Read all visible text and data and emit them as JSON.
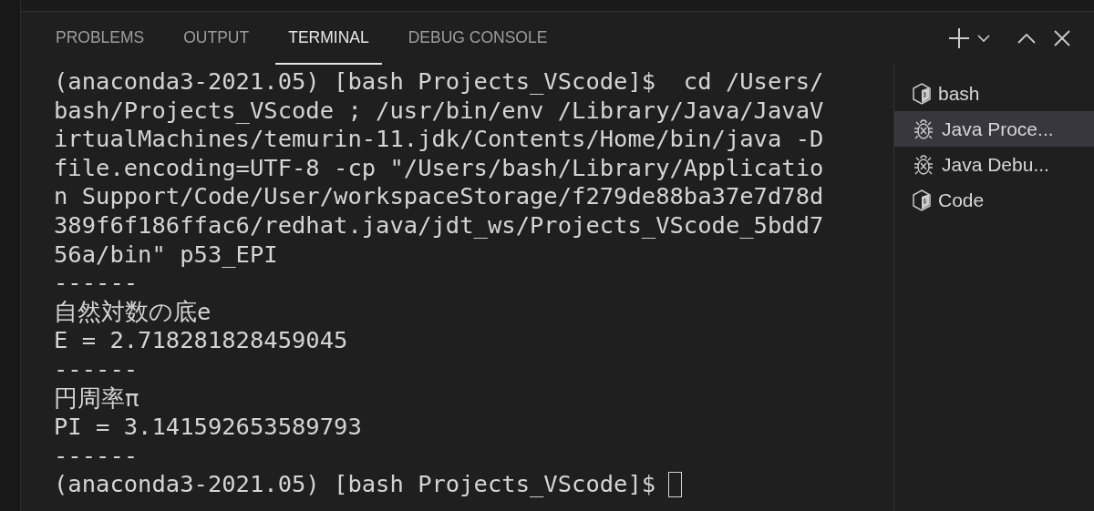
{
  "panel": {
    "tabs": [
      {
        "label": "PROBLEMS",
        "selected": false
      },
      {
        "label": "OUTPUT",
        "selected": false
      },
      {
        "label": "TERMINAL",
        "selected": true
      },
      {
        "label": "DEBUG CONSOLE",
        "selected": false
      }
    ]
  },
  "terminal": {
    "lines": [
      "(anaconda3-2021.05) [bash Projects_VScode]$  cd /Users/",
      "bash/Projects_VScode ; /usr/bin/env /Library/Java/JavaV",
      "irtualMachines/temurin-11.jdk/Contents/Home/bin/java -D",
      "file.encoding=UTF-8 -cp \"/Users/bash/Library/Applicatio",
      "n Support/Code/User/workspaceStorage/f279de88ba37e7d78d",
      "389f6f186ffac6/redhat.java/jdt_ws/Projects_VScode_5bdd7",
      "56a/bin\" p53_EPI",
      "------",
      "自然対数の底e",
      "E = 2.718281828459045",
      "------",
      "円周率π",
      "PI = 3.141592653589793",
      "------"
    ],
    "prompt": "(anaconda3-2021.05) [bash Projects_VScode]$"
  },
  "terminal_list": [
    {
      "kind": "shell",
      "label": "bash",
      "selected": false
    },
    {
      "kind": "debug",
      "label": "Java Proce...",
      "selected": true
    },
    {
      "kind": "debug",
      "label": "Java Debu...",
      "selected": false
    },
    {
      "kind": "shell",
      "label": "Code",
      "selected": false
    }
  ]
}
